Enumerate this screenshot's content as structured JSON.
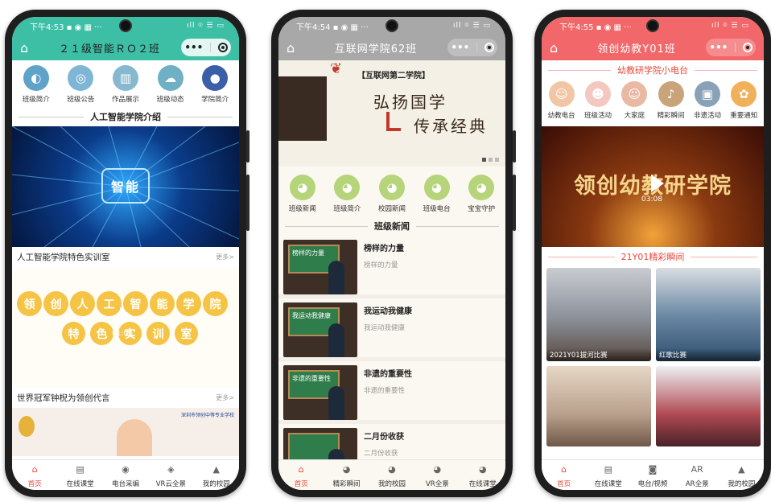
{
  "phone1": {
    "status_time": "下午4:53",
    "status_icons": "▪ ◉ ▦ ···",
    "status_right": "ıll ⌾ ☰ ▭",
    "title": "２１级智能ＲＯ２班",
    "capsule_dots": "•••",
    "icons": [
      {
        "label": "班级简介",
        "icon": "globe-icon",
        "glyph": "◐",
        "color": "#5fa3c9"
      },
      {
        "label": "班级公告",
        "icon": "megaphone-icon",
        "glyph": "◎",
        "color": "#7fb6d6"
      },
      {
        "label": "作品展示",
        "icon": "chart-icon",
        "glyph": "▥",
        "color": "#86b8cf"
      },
      {
        "label": "班级动态",
        "icon": "cloud-icon",
        "glyph": "☁",
        "color": "#6fb0c4"
      },
      {
        "label": "学院简介",
        "icon": "college-badge-icon",
        "glyph": "●",
        "color": "#3a5ea8"
      }
    ],
    "intro_heading": "人工智能学院介绍",
    "banner_logo": "智能",
    "video1_title": "人工智能学院特色实训室",
    "more": "更多>",
    "video_chars_row1": [
      "领",
      "创",
      "人",
      "工",
      "智",
      "能",
      "学",
      "院"
    ],
    "video_chars_row2": [
      "特",
      "色",
      "实",
      "训",
      "室"
    ],
    "video_time": "01:06",
    "video2_title": "世界冠军钟棿为领创代言",
    "video2_logo": "深圳市领创中等专业学校",
    "tabs": [
      {
        "label": "首页",
        "icon": "home-tab-icon",
        "glyph": "⌂",
        "active": true
      },
      {
        "label": "在线课堂",
        "icon": "classroom-icon",
        "glyph": "▤",
        "active": false
      },
      {
        "label": "电台采编",
        "icon": "radio-icon",
        "glyph": "◉",
        "active": false
      },
      {
        "label": "VR云全景",
        "icon": "vr-icon",
        "glyph": "◈",
        "active": false
      },
      {
        "label": "我的校园",
        "icon": "campus-icon",
        "glyph": "▲",
        "active": false
      }
    ]
  },
  "phone2": {
    "status_time": "下午4:54",
    "status_icons": "▪ ◉ ▦ ···",
    "status_right": "ıll ⌾ ☰ ▭",
    "title": "互联网学院62班",
    "capsule_dots": "•••",
    "banner_heading": "【互联网第二学院】",
    "banner_line1": "弘扬国学",
    "banner_line2": "传承经典",
    "icons": [
      {
        "label": "班级新闻",
        "icon": "bird-icon",
        "glyph": "◕",
        "color": "#b6d47a"
      },
      {
        "label": "班级简介",
        "icon": "bird-icon",
        "glyph": "◕",
        "color": "#b6d47a"
      },
      {
        "label": "校园新闻",
        "icon": "bird-icon",
        "glyph": "◕",
        "color": "#b6d47a"
      },
      {
        "label": "班级电台",
        "icon": "bird-icon",
        "glyph": "◕",
        "color": "#b6d47a"
      },
      {
        "label": "宝宝守护",
        "icon": "bird-icon",
        "glyph": "◕",
        "color": "#b6d47a"
      }
    ],
    "news_heading": "班级新闻",
    "news": [
      {
        "title": "榜样的力量",
        "sub": "榜样的力量",
        "board": "榜样的力量"
      },
      {
        "title": "我运动我健康",
        "sub": "我运动我健康",
        "board": "我运动我健康"
      },
      {
        "title": "非遗的重要性",
        "sub": "非遗的重要性",
        "board": "非遗的重要性"
      },
      {
        "title": "二月份收获",
        "sub": "二月份收获",
        "board": ""
      }
    ],
    "tabs": [
      {
        "label": "首页",
        "icon": "home-tab-icon",
        "glyph": "⌂",
        "active": true
      },
      {
        "label": "精彩瞬间",
        "icon": "bird-tab-icon",
        "glyph": "◕",
        "active": false
      },
      {
        "label": "我的校园",
        "icon": "bird-tab-icon",
        "glyph": "◕",
        "active": false
      },
      {
        "label": "VR全景",
        "icon": "bird-tab-icon",
        "glyph": "◕",
        "active": false
      },
      {
        "label": "在线课堂",
        "icon": "bird-tab-icon",
        "glyph": "◕",
        "active": false
      }
    ]
  },
  "phone3": {
    "status_time": "下午4:55",
    "status_icons": "▪ ◉ ▦ ···",
    "status_right": "ıll ⌾ ☰ ▭",
    "title": "领创幼教Y01班",
    "capsule_dots": "•••",
    "radio_heading": "幼教研学院小电台",
    "icons": [
      {
        "label": "幼教电台",
        "icon": "kids-radio-icon",
        "glyph": "☺",
        "color": "#f2c6a4"
      },
      {
        "label": "班级活动",
        "icon": "kids-activity-icon",
        "glyph": "☻",
        "color": "#f4c7c0"
      },
      {
        "label": "大家庭",
        "icon": "family-icon",
        "glyph": "☺",
        "color": "#e9b9a3"
      },
      {
        "label": "精彩瞬间",
        "icon": "piano-icon",
        "glyph": "♪",
        "color": "#c9a37a"
      },
      {
        "label": "非遗活动",
        "icon": "heritage-icon",
        "glyph": "▣",
        "color": "#8aa2b8"
      },
      {
        "label": "重要通知",
        "icon": "notice-icon",
        "glyph": "✿",
        "color": "#f0b15c"
      }
    ],
    "video_title": "领创幼教研学院",
    "video_time": "03:08",
    "moments_heading": "21Y01精彩瞬间",
    "photos": [
      {
        "caption": "2021Y01拔河比赛"
      },
      {
        "caption": "红歌比赛"
      },
      {
        "caption": ""
      },
      {
        "caption": ""
      }
    ],
    "tabs": [
      {
        "label": "首页",
        "icon": "home-house-icon",
        "glyph": "⌂",
        "active": true
      },
      {
        "label": "在线课堂",
        "icon": "blackboard-icon",
        "glyph": "▤",
        "active": false
      },
      {
        "label": "电台/视频",
        "icon": "camera-icon",
        "glyph": "◙",
        "active": false
      },
      {
        "label": "AR全景",
        "icon": "ar-icon",
        "glyph": "AR",
        "active": false
      },
      {
        "label": "我的校园",
        "icon": "school-icon",
        "glyph": "▲",
        "active": false
      }
    ]
  },
  "colors": {
    "teal": "#3dbfa6",
    "gray_nav": "#a8a8a8",
    "coral": "#f2676a",
    "active_tab": "#e8483a"
  }
}
